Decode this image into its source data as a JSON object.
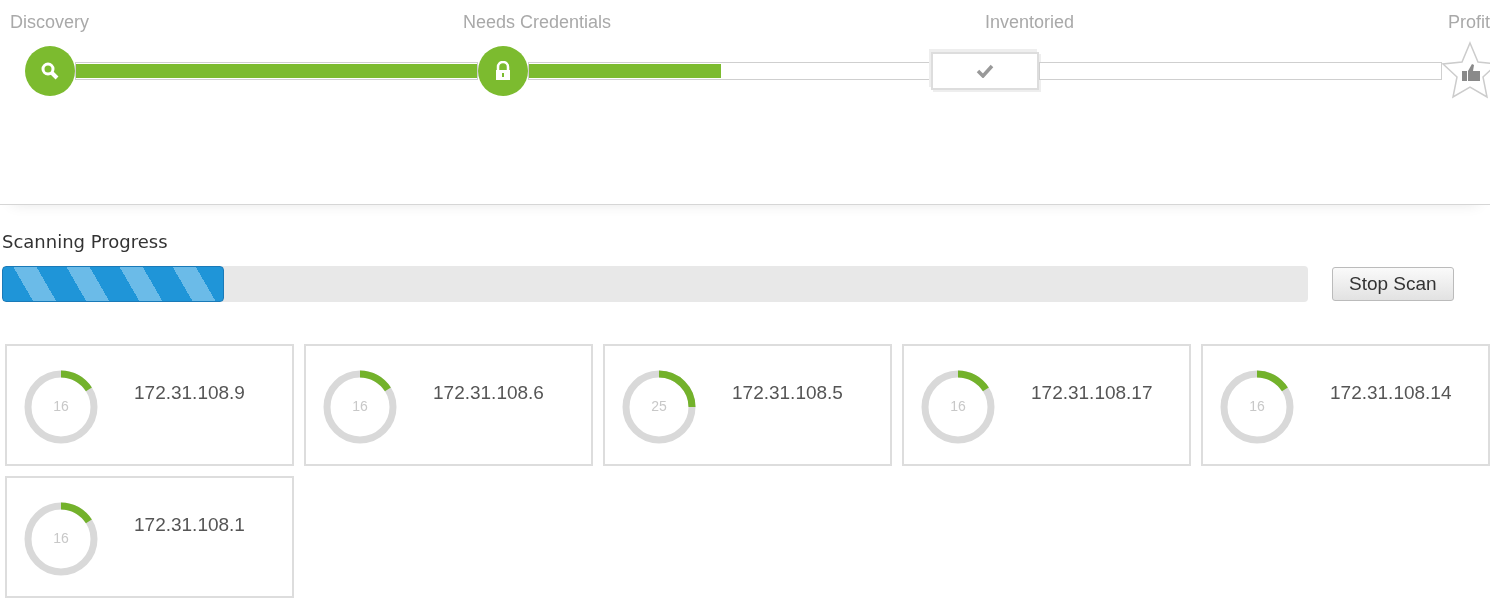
{
  "stepper": {
    "segments": [
      {
        "level": 1
      },
      {
        "level": 0.48
      },
      {
        "level": 0
      }
    ],
    "steps": [
      {
        "label": "Discovery",
        "kind": "search",
        "completed": true
      },
      {
        "label": "Needs Credentials",
        "kind": "lock",
        "completed": true
      },
      {
        "label": "Inventoried",
        "kind": "check",
        "completed": false
      },
      {
        "label": "Profit",
        "kind": "star",
        "completed": false
      }
    ]
  },
  "scan": {
    "title": "Scanning Progress",
    "level": 0.17,
    "button": "Stop Scan"
  },
  "hosts": [
    {
      "address": "172.31.108.9",
      "count": "16",
      "level": 0.16
    },
    {
      "address": "172.31.108.6",
      "count": "16",
      "level": 0.16
    },
    {
      "address": "172.31.108.5",
      "count": "25",
      "level": 0.25
    },
    {
      "address": "172.31.108.17",
      "count": "16",
      "level": 0.16
    },
    {
      "address": "172.31.108.14",
      "count": "16",
      "level": 0.16
    },
    {
      "address": "172.31.108.1",
      "count": "16",
      "level": 0.16
    }
  ]
}
